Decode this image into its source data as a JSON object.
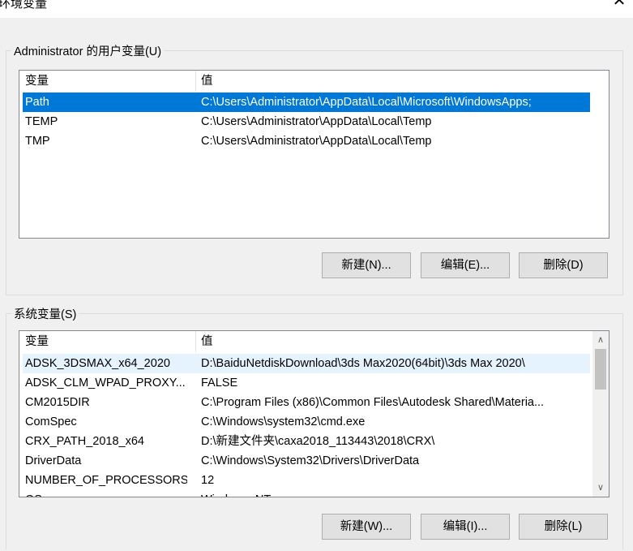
{
  "window": {
    "title": "环境变量",
    "close_glyph": "✕"
  },
  "user_vars": {
    "legend": "Administrator 的用户变量(U)",
    "col_name": "变量",
    "col_value": "值",
    "rows": [
      {
        "name": "Path",
        "value": "C:\\Users\\Administrator\\AppData\\Local\\Microsoft\\WindowsApps;"
      },
      {
        "name": "TEMP",
        "value": "C:\\Users\\Administrator\\AppData\\Local\\Temp"
      },
      {
        "name": "TMP",
        "value": "C:\\Users\\Administrator\\AppData\\Local\\Temp"
      }
    ],
    "new_label": "新建(N)...",
    "edit_label": "编辑(E)...",
    "delete_label": "删除(D)"
  },
  "system_vars": {
    "legend": "系统变量(S)",
    "col_name": "变量",
    "col_value": "值",
    "rows": [
      {
        "name": "ADSK_3DSMAX_x64_2020",
        "value": "D:\\BaiduNetdiskDownload\\3ds Max2020(64bit)\\3ds Max 2020\\"
      },
      {
        "name": "ADSK_CLM_WPAD_PROXY...",
        "value": "FALSE"
      },
      {
        "name": "CM2015DIR",
        "value": "C:\\Program Files (x86)\\Common Files\\Autodesk Shared\\Materia..."
      },
      {
        "name": "ComSpec",
        "value": "C:\\Windows\\system32\\cmd.exe"
      },
      {
        "name": "CRX_PATH_2018_x64",
        "value": "D:\\新建文件夹\\caxa2018_113443\\2018\\CRX\\"
      },
      {
        "name": "DriverData",
        "value": "C:\\Windows\\System32\\Drivers\\DriverData"
      },
      {
        "name": "NUMBER_OF_PROCESSORS",
        "value": "12"
      },
      {
        "name": "OS",
        "value": "Windows_NT"
      }
    ],
    "scroll_up": "∧",
    "scroll_down": "∨",
    "new_label": "新建(W)...",
    "edit_label": "编辑(I)...",
    "delete_label": "删除(L)"
  }
}
